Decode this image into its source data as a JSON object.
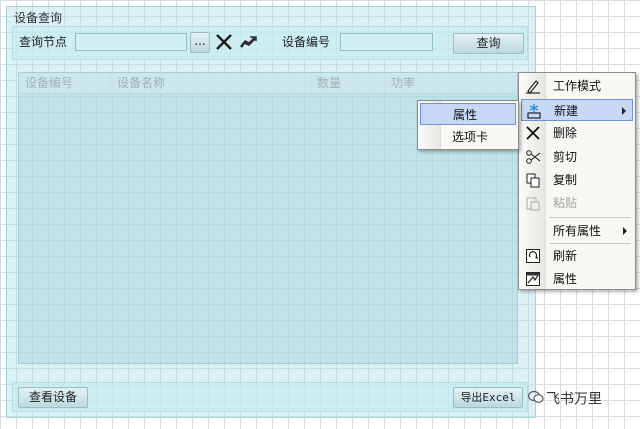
{
  "group": {
    "title": "设备查询"
  },
  "query_bar": {
    "node_label": "查询节点",
    "node_value": "",
    "browse_label": "...",
    "device_no_label": "设备编号",
    "device_no_value": "",
    "query_button": "查询"
  },
  "table": {
    "columns": [
      "设备编号",
      "设备名称",
      "数量",
      "功率"
    ]
  },
  "bottom": {
    "view_button": "查看设备",
    "export_button": "导出Excel"
  },
  "context_menu": {
    "items": [
      {
        "label": "工作模式",
        "icon": "pen-icon"
      },
      {
        "label": "新建",
        "icon": "new-icon",
        "submenu": true,
        "highlighted": true
      },
      {
        "label": "删除",
        "icon": "delete-x-icon"
      },
      {
        "label": "剪切",
        "icon": "scissors-icon"
      },
      {
        "label": "复制",
        "icon": "copy-icon"
      },
      {
        "label": "粘贴",
        "icon": "paste-icon",
        "disabled": true
      },
      {
        "label": "所有属性",
        "icon": "",
        "submenu": true
      },
      {
        "label": "刷新",
        "icon": "refresh-icon"
      },
      {
        "label": "属性",
        "icon": "properties-icon"
      }
    ]
  },
  "submenu": {
    "items": [
      {
        "label": "属性",
        "highlighted": true
      },
      {
        "label": "选项卡"
      }
    ]
  },
  "watermark": {
    "text": "飞书万里"
  }
}
